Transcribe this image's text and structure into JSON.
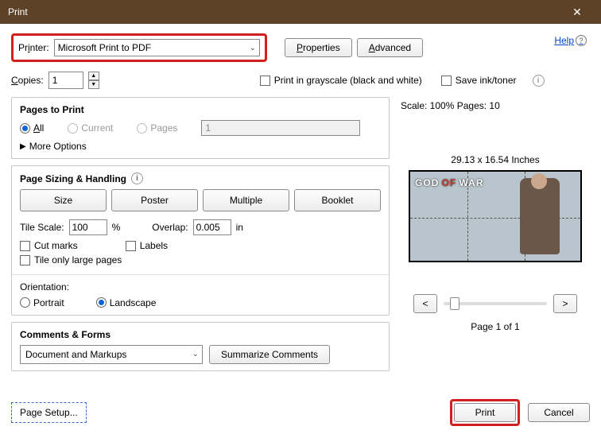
{
  "titlebar": {
    "title": "Print"
  },
  "help": {
    "label": "Help"
  },
  "printer": {
    "label_pre": "Pr",
    "label_u": "i",
    "label_post": "nter:",
    "selected": "Microsoft Print to PDF",
    "properties_u": "P",
    "properties_rest": "roperties",
    "advanced_u": "A",
    "advanced_rest": "dvanced"
  },
  "copies": {
    "label_u": "C",
    "label_rest": "opies:",
    "value": "1",
    "grayscale": "Print in grayscale (black and white)",
    "saveink": "Save ink/toner"
  },
  "pages": {
    "title": "Pages to Print",
    "all_u": "A",
    "all_rest": "ll",
    "current": "Current",
    "pages": "Pages",
    "pages_value": "1",
    "more": "More Options"
  },
  "sizing": {
    "title": "Page Sizing & Handling",
    "size": "Size",
    "poster": "Poster",
    "multiple": "Multiple",
    "booklet": "Booklet",
    "tilescale_label": "Tile Scale:",
    "tilescale_value": "100",
    "percent": "%",
    "overlap_label": "Overlap:",
    "overlap_value": "0.005",
    "overlap_unit": "in",
    "cutmarks": "Cut marks",
    "labels": "Labels",
    "tilelarge": "Tile only large pages"
  },
  "orientation": {
    "title": "Orientation:",
    "portrait": "Portrait",
    "landscape": "Landscape"
  },
  "comments": {
    "title": "Comments & Forms",
    "selected": "Document and Markups",
    "summarize": "Summarize Comments"
  },
  "preview": {
    "header": "Scale: 100% Pages: 10",
    "caption": "29.13 x 16.54 Inches",
    "logo1": "GOD",
    "logo2": "OF",
    "logo3": "WAR",
    "prev": "<",
    "next": ">",
    "page_of": "Page 1 of 1"
  },
  "footer": {
    "pagesetup": "Page Setup...",
    "print": "Print",
    "cancel": "Cancel"
  }
}
